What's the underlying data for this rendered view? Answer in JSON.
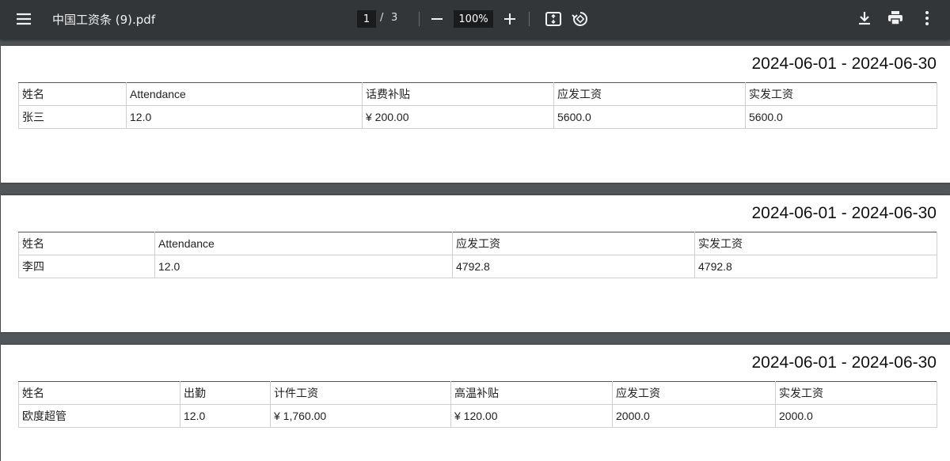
{
  "toolbar": {
    "title": "中国工资条 (9).pdf",
    "page_current": "1",
    "page_separator": "/",
    "page_total": "3",
    "zoom": "100%",
    "icons": {
      "menu": "menu-icon",
      "zoom_out": "minus-icon",
      "zoom_in": "plus-icon",
      "fit": "fit-to-page-icon",
      "rotate": "rotate-icon",
      "download": "download-icon",
      "print": "print-icon",
      "more": "more-vert-icon"
    }
  },
  "pages": [
    {
      "period": "2024-06-01 - 2024-06-30",
      "headers": [
        "姓名",
        "Attendance",
        "话费补贴",
        "应发工资",
        "实发工资"
      ],
      "rows": [
        [
          "张三",
          "12.0",
          "¥ 200.00",
          "5600.0",
          "5600.0"
        ]
      ]
    },
    {
      "period": "2024-06-01 - 2024-06-30",
      "headers": [
        "姓名",
        "Attendance",
        "应发工资",
        "实发工资"
      ],
      "rows": [
        [
          "李四",
          "12.0",
          "4792.8",
          "4792.8"
        ]
      ]
    },
    {
      "period": "2024-06-01 - 2024-06-30",
      "headers": [
        "姓名",
        "出勤",
        "计件工资",
        "高温补贴",
        "应发工资",
        "实发工资"
      ],
      "rows": [
        [
          "欧度超管",
          "12.0",
          "¥ 1,760.00",
          "¥ 120.00",
          "2000.0",
          "2000.0"
        ]
      ]
    }
  ]
}
